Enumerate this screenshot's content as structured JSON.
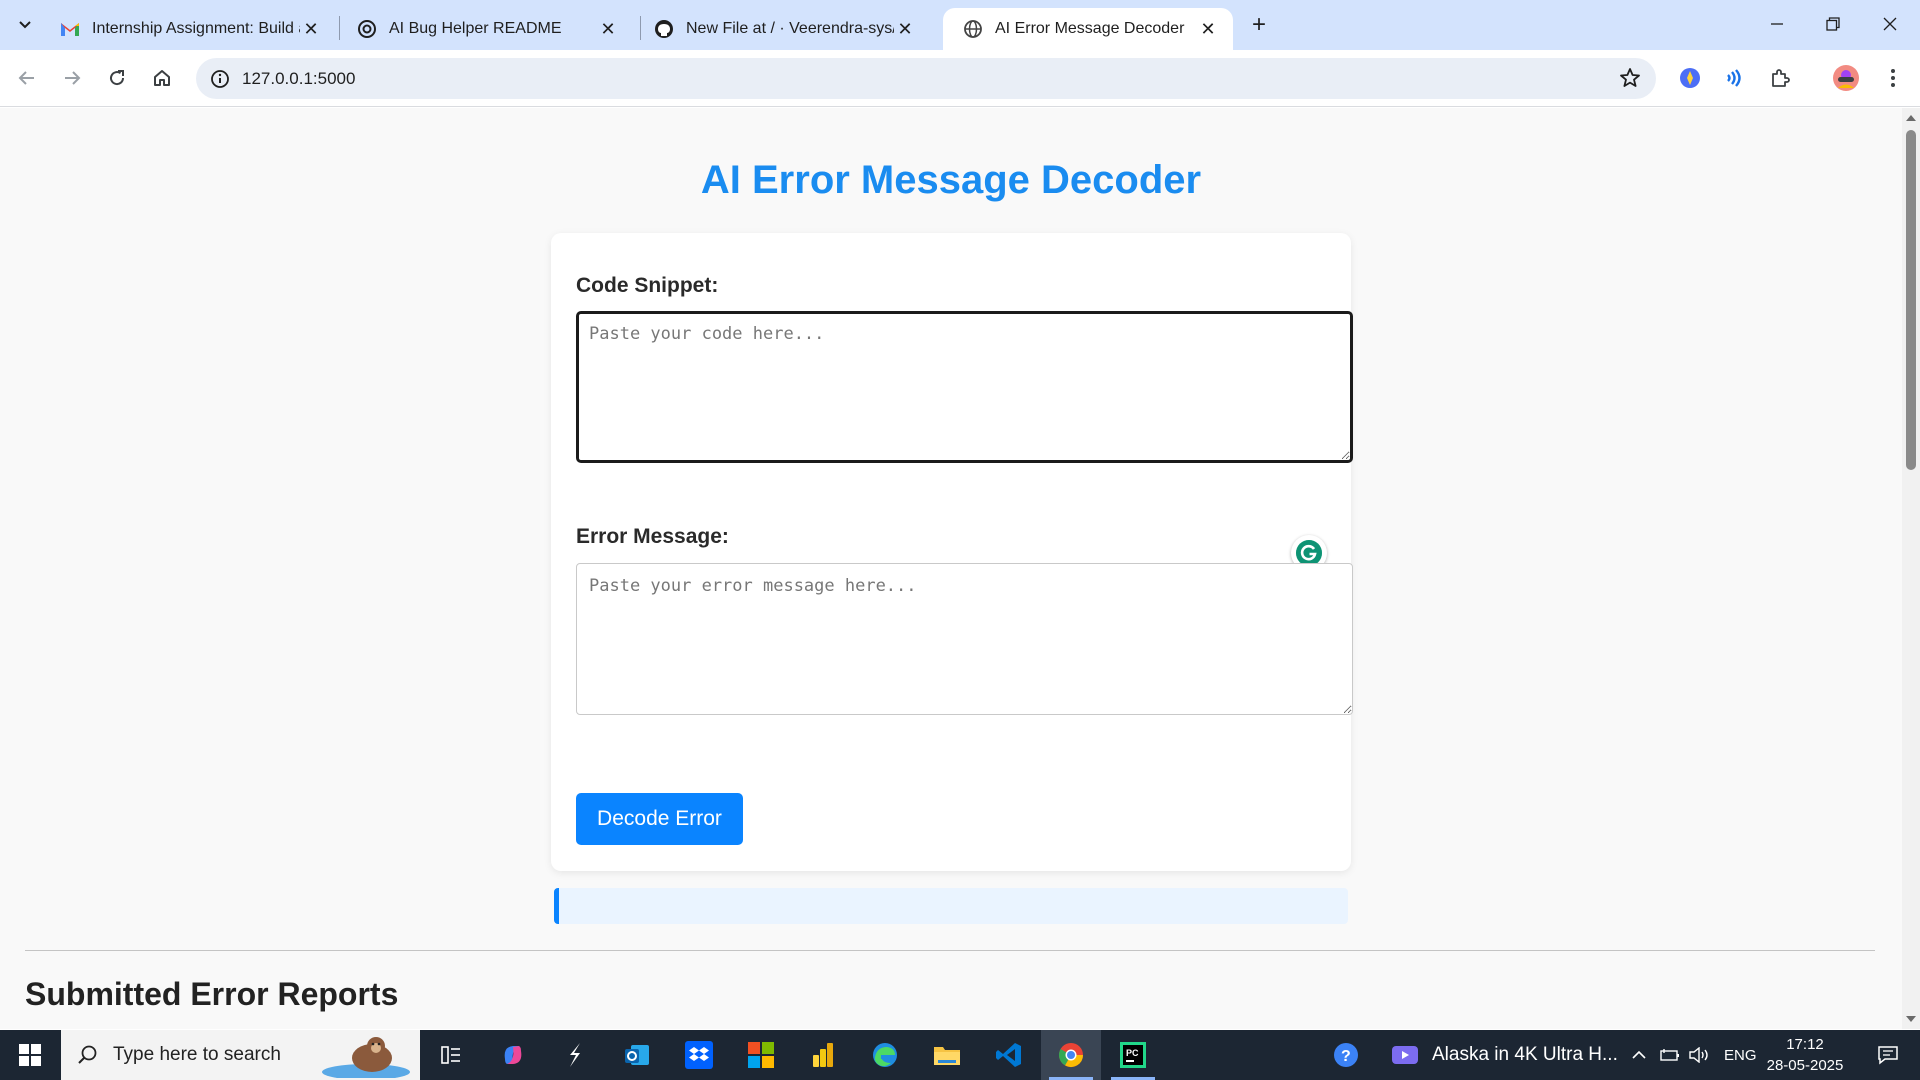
{
  "browser": {
    "tabs": [
      {
        "title": "Internship Assignment: Build a T",
        "icon": "gmail-icon"
      },
      {
        "title": "AI Bug Helper README",
        "icon": "chatgpt-icon"
      },
      {
        "title": "New File at / · Veerendra-sys/M",
        "icon": "github-icon"
      },
      {
        "title": "AI Error Message Decoder",
        "icon": "globe-icon",
        "active": true
      }
    ],
    "url": "127.0.0.1:5000"
  },
  "page": {
    "title": "AI Error Message Decoder",
    "code_label": "Code Snippet:",
    "code_placeholder": "Paste your code here...",
    "error_label": "Error Message:",
    "error_placeholder": "Paste your error message here...",
    "button_label": "Decode Error",
    "reports_title": "Submitted Error Reports"
  },
  "taskbar": {
    "search_placeholder": "Type here to search",
    "media_title": "Alaska in 4K Ultra H...",
    "language": "ENG",
    "time": "17:12",
    "date": "28-05-2025"
  },
  "colors": {
    "accent": "#0a84ff",
    "title": "#1a8cf0",
    "tabstrip": "#d3e3fd"
  }
}
